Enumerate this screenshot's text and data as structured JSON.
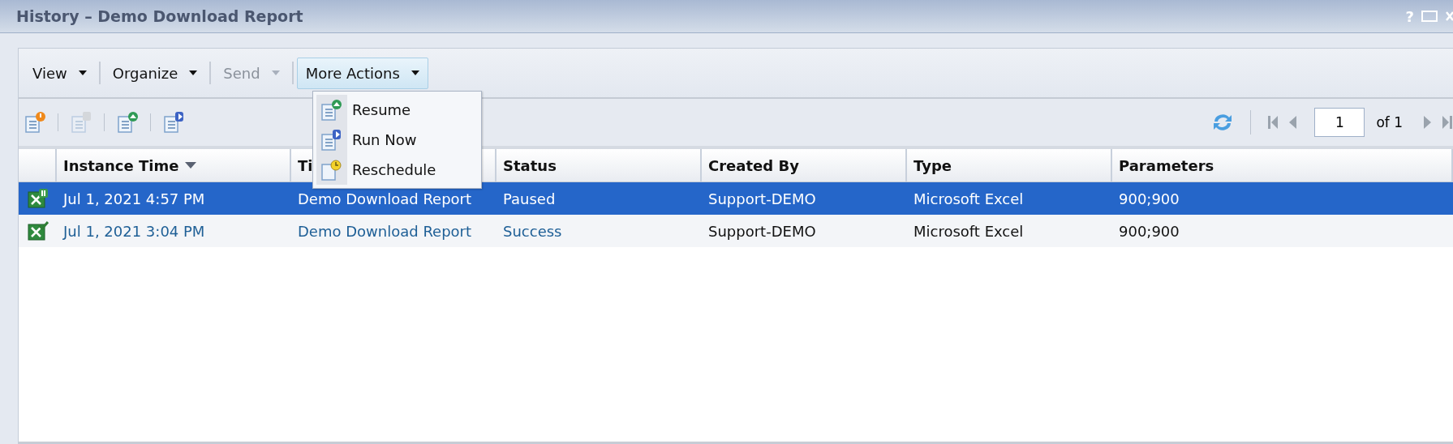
{
  "window": {
    "title": "History – Demo Download Report",
    "help": "?"
  },
  "menu_bar": [
    {
      "label": "View",
      "disabled": false,
      "expanded": false
    },
    {
      "label": "Organize",
      "disabled": false,
      "expanded": false
    },
    {
      "label": "Send",
      "disabled": true,
      "expanded": false
    },
    {
      "label": "More Actions",
      "disabled": false,
      "expanded": true
    }
  ],
  "dropdown_menu": [
    {
      "label": "Resume",
      "kind": "resume"
    },
    {
      "label": "Run Now",
      "kind": "run"
    },
    {
      "label": "Reschedule",
      "kind": "reschedule"
    }
  ],
  "icon_toolbar": [
    {
      "kind": "alert",
      "disabled": false
    },
    {
      "kind": "pause",
      "disabled": true
    },
    {
      "kind": "resume",
      "disabled": false
    },
    {
      "kind": "run",
      "disabled": false
    }
  ],
  "pager": {
    "page": "1",
    "total": "of 1"
  },
  "table": {
    "columns": [
      {
        "label": "Instance Time",
        "sorted": true,
        "link": true
      },
      {
        "label": "Ti",
        "sorted": false,
        "link": true
      },
      {
        "label": "Status",
        "sorted": false,
        "link": true
      },
      {
        "label": "Created By",
        "sorted": false,
        "link": false
      },
      {
        "label": "Type",
        "sorted": false,
        "link": false
      },
      {
        "label": "Parameters",
        "sorted": false,
        "link": false
      }
    ],
    "rows": [
      {
        "selected": true,
        "kind": "paused",
        "cells": [
          "Jul 1, 2021 4:57 PM",
          "Demo Download Report",
          "Paused",
          "Support-DEMO",
          "Microsoft Excel",
          "900;900"
        ]
      },
      {
        "selected": false,
        "kind": "success",
        "cells": [
          "Jul 1, 2021 3:04 PM",
          "Demo Download Report",
          "Success",
          "Support-DEMO",
          "Microsoft Excel",
          "900;900"
        ]
      }
    ]
  }
}
